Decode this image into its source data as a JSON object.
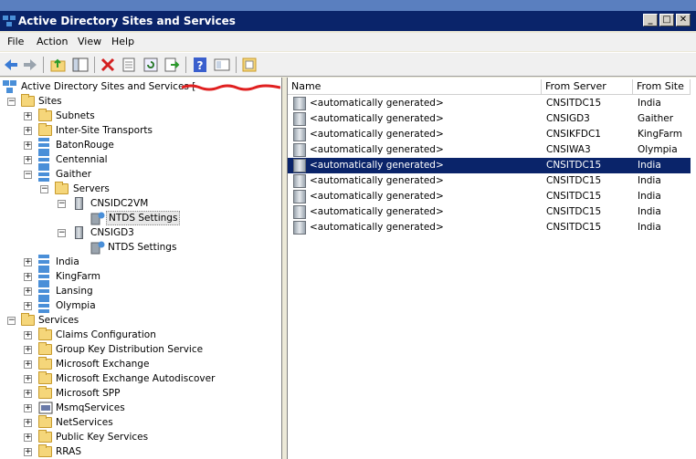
{
  "window": {
    "title": "Active Directory Sites and Services"
  },
  "menu": [
    "File",
    "Action",
    "View",
    "Help"
  ],
  "toolbar_icons": [
    "back-arrow-icon",
    "forward-arrow-icon",
    "up-folder-icon",
    "show-hide-tree-icon",
    "delete-icon",
    "properties-icon",
    "refresh-icon",
    "export-icon",
    "help-icon",
    "console-tree-icon",
    "filter-icon"
  ],
  "tree": {
    "root": "Active Directory Sites and Services [",
    "sites": "Sites",
    "subnets": "Subnets",
    "transports": "Inter-Site Transports",
    "batonrouge": "BatonRouge",
    "centennial": "Centennial",
    "gaither": "Gaither",
    "servers": "Servers",
    "cnsidc2vm": "CNSIDC2VM",
    "ntds1": "NTDS Settings",
    "cnsigd3": "CNSIGD3",
    "ntds2": "NTDS Settings",
    "india": "India",
    "kingfarm": "KingFarm",
    "lansing": "Lansing",
    "olympia": "Olympia",
    "services": "Services",
    "claims": "Claims Configuration",
    "gkds": "Group Key Distribution Service",
    "exchange": "Microsoft Exchange",
    "exchange_auto": "Microsoft Exchange Autodiscover",
    "spp": "Microsoft SPP",
    "msmq": "MsmqServices",
    "netservices": "NetServices",
    "pks": "Public Key Services",
    "rras": "RRAS"
  },
  "list": {
    "headers": {
      "name": "Name",
      "from_server": "From Server",
      "from_site": "From Site"
    },
    "rows": [
      {
        "name": "<automatically generated>",
        "server": "CNSITDC15",
        "site": "India"
      },
      {
        "name": "<automatically generated>",
        "server": "CNSIGD3",
        "site": "Gaither"
      },
      {
        "name": "<automatically generated>",
        "server": "CNSIKFDC1",
        "site": "KingFarm"
      },
      {
        "name": "<automatically generated>",
        "server": "CNSIWA3",
        "site": "Olympia"
      },
      {
        "name": "<automatically generated>",
        "server": "CNSITDC15",
        "site": "India"
      },
      {
        "name": "<automatically generated>",
        "server": "CNSITDC15",
        "site": "India"
      },
      {
        "name": "<automatically generated>",
        "server": "CNSITDC15",
        "site": "India"
      },
      {
        "name": "<automatically generated>",
        "server": "CNSITDC15",
        "site": "India"
      },
      {
        "name": "<automatically generated>",
        "server": "CNSITDC15",
        "site": "India"
      }
    ],
    "selected_index": 4
  }
}
